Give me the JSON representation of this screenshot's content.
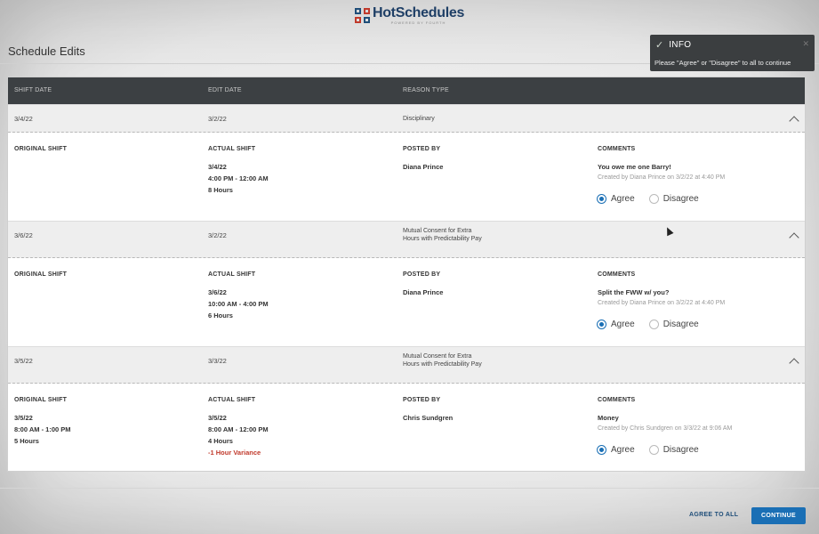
{
  "brand": {
    "name": "HotSchedules",
    "tagline": "POWERED BY FOURTH"
  },
  "page": {
    "title": "Schedule Edits"
  },
  "toast": {
    "title": "INFO",
    "message": "Please \"Agree\" or \"Disagree\" to all to continue",
    "icon": "check-icon"
  },
  "table": {
    "headers": [
      "SHIFT DATE",
      "EDIT DATE",
      "REASON TYPE"
    ],
    "detail_labels": {
      "original": "ORIGINAL SHIFT",
      "actual": "ACTUAL SHIFT",
      "posted": "POSTED BY",
      "comments": "COMMENTS"
    },
    "radio_labels": {
      "agree": "Agree",
      "disagree": "Disagree"
    },
    "rows": [
      {
        "shift_date": "3/4/22",
        "edit_date": "3/2/22",
        "reason": "Disciplinary",
        "original": [
          "",
          "",
          ""
        ],
        "actual": [
          "3/4/22",
          "4:00 PM - 12:00 AM",
          "8 Hours"
        ],
        "variance": "",
        "posted_by": "Diana Prince",
        "comment": "You owe me one Barry!",
        "created": "Created by Diana Prince on 3/2/22 at 4:40 PM",
        "selected": "agree"
      },
      {
        "shift_date": "3/6/22",
        "edit_date": "3/2/22",
        "reason": "Mutual Consent for Extra Hours with Predictability Pay",
        "original": [
          "",
          "",
          ""
        ],
        "actual": [
          "3/6/22",
          "10:00 AM - 4:00 PM",
          "6 Hours"
        ],
        "variance": "",
        "posted_by": "Diana Prince",
        "comment": "Split the FWW w/ you?",
        "created": "Created by Diana Prince on 3/2/22 at 4:40 PM",
        "selected": "agree"
      },
      {
        "shift_date": "3/5/22",
        "edit_date": "3/3/22",
        "reason": "Mutual Consent for Extra Hours with Predictability Pay",
        "original": [
          "3/5/22",
          "8:00 AM - 1:00 PM",
          "5 Hours"
        ],
        "actual": [
          "3/5/22",
          "8:00 AM - 12:00 PM",
          "4 Hours"
        ],
        "variance": "-1 Hour Variance",
        "posted_by": "Chris Sundgren",
        "comment": "Money",
        "created": "Created by Chris Sundgren on 3/3/22 at 9:06 AM",
        "selected": "agree"
      }
    ]
  },
  "footer": {
    "agree_all": "AGREE TO ALL",
    "continue": "CONTINUE"
  },
  "colors": {
    "header_bg": "#3c4043",
    "accent": "#1a6fb5",
    "variance": "#c0392b",
    "brand_navy": "#1f3f66"
  }
}
